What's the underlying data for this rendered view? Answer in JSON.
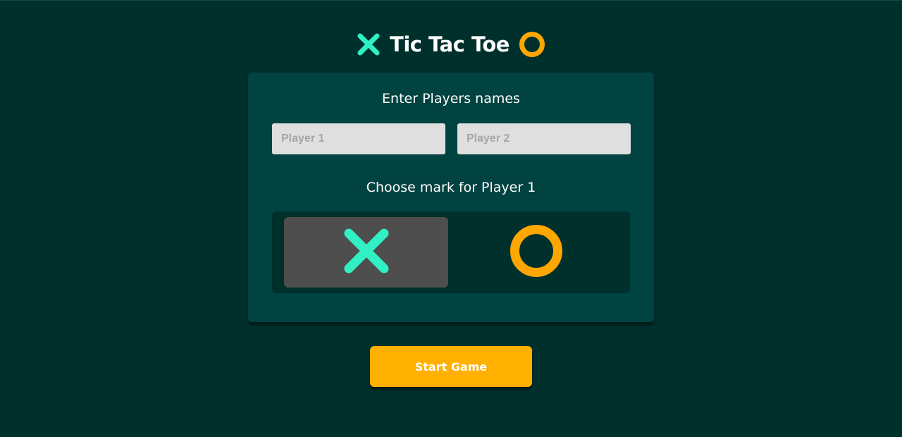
{
  "header": {
    "title": "Tic Tac Toe",
    "left_icon": "x-mark-icon",
    "right_icon": "o-mark-icon"
  },
  "setup": {
    "names_heading": "Enter Players names",
    "player1_placeholder": "Player 1",
    "player2_placeholder": "Player 2",
    "player1_value": "",
    "player2_value": "",
    "mark_heading": "Choose mark for Player 1",
    "mark_options": [
      {
        "icon": "x-mark-icon",
        "selected": true
      },
      {
        "icon": "o-mark-icon",
        "selected": false
      }
    ]
  },
  "start_button_label": "Start Game",
  "colors": {
    "background": "#00302c",
    "card": "#004340",
    "x_mark": "#31f0c4",
    "o_mark": "#ffa600",
    "start_button": "#ffb000",
    "selected_option": "#4e4e4e"
  }
}
